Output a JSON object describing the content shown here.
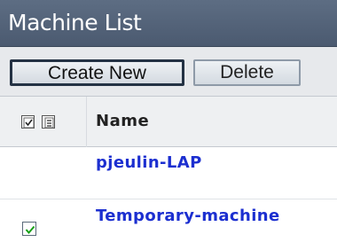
{
  "panel": {
    "title": "Machine List"
  },
  "toolbar": {
    "create_label": "Create New",
    "delete_label": "Delete"
  },
  "table": {
    "name_header": "Name",
    "rows": [
      {
        "name": "pjeulin-LAP",
        "checked": false
      },
      {
        "name": "Temporary-machine",
        "checked": true
      }
    ]
  },
  "icons": {
    "select_all": "select-all-icon",
    "deselect_all": "deselect-all-icon",
    "row_checkbox": "checkbox-icon"
  },
  "colors": {
    "title_bar": "#54647a",
    "link": "#1c2fd0",
    "check": "#16a016"
  }
}
